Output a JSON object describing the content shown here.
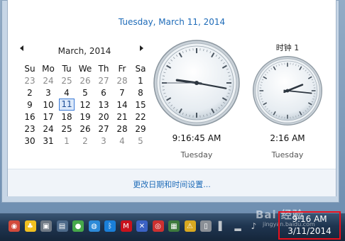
{
  "flyout": {
    "date_heading": "Tuesday, March 11, 2014",
    "settings_link": "更改日期和时间设置..."
  },
  "calendar": {
    "prev_icon": "triangle-left",
    "next_icon": "triangle-right",
    "month_title": "March, 2014",
    "weekdays": [
      "Su",
      "Mo",
      "Tu",
      "We",
      "Th",
      "Fr",
      "Sa"
    ],
    "weeks": [
      [
        {
          "d": "23",
          "o": true
        },
        {
          "d": "24",
          "o": true
        },
        {
          "d": "25",
          "o": true
        },
        {
          "d": "26",
          "o": true
        },
        {
          "d": "27",
          "o": true
        },
        {
          "d": "28",
          "o": true
        },
        {
          "d": "1",
          "o": false
        }
      ],
      [
        {
          "d": "2",
          "o": false
        },
        {
          "d": "3",
          "o": false
        },
        {
          "d": "4",
          "o": false
        },
        {
          "d": "5",
          "o": false
        },
        {
          "d": "6",
          "o": false
        },
        {
          "d": "7",
          "o": false
        },
        {
          "d": "8",
          "o": false
        }
      ],
      [
        {
          "d": "9",
          "o": false
        },
        {
          "d": "10",
          "o": false
        },
        {
          "d": "11",
          "o": false,
          "today": true
        },
        {
          "d": "12",
          "o": false
        },
        {
          "d": "13",
          "o": false
        },
        {
          "d": "14",
          "o": false
        },
        {
          "d": "15",
          "o": false
        }
      ],
      [
        {
          "d": "16",
          "o": false
        },
        {
          "d": "17",
          "o": false
        },
        {
          "d": "18",
          "o": false
        },
        {
          "d": "19",
          "o": false
        },
        {
          "d": "20",
          "o": false
        },
        {
          "d": "21",
          "o": false
        },
        {
          "d": "22",
          "o": false
        }
      ],
      [
        {
          "d": "23",
          "o": false
        },
        {
          "d": "24",
          "o": false
        },
        {
          "d": "25",
          "o": false
        },
        {
          "d": "26",
          "o": false
        },
        {
          "d": "27",
          "o": false
        },
        {
          "d": "28",
          "o": false
        },
        {
          "d": "29",
          "o": false
        }
      ],
      [
        {
          "d": "30",
          "o": false
        },
        {
          "d": "31",
          "o": false
        },
        {
          "d": "1",
          "o": true
        },
        {
          "d": "2",
          "o": true
        },
        {
          "d": "3",
          "o": true
        },
        {
          "d": "4",
          "o": true
        },
        {
          "d": "5",
          "o": true
        }
      ]
    ]
  },
  "clocks": [
    {
      "name": "",
      "time": "9:16:45 AM",
      "day": "Tuesday",
      "hour": 9,
      "minute": 16,
      "second": 45
    },
    {
      "name": "时钟 1",
      "time": "2:16 AM",
      "day": "Tuesday",
      "hour": 2,
      "minute": 16,
      "second": null
    }
  ],
  "taskbar": {
    "time": "9:16 AM",
    "date": "3/11/2014",
    "tray_icons": [
      "chrome-icon",
      "qq-icon",
      "app-icon",
      "network-share-icon",
      "wechat-icon",
      "browser-icon",
      "bluetooth-icon",
      "mcafee-icon",
      "security-icon",
      "power-icon",
      "flag-icon",
      "warning-icon",
      "usb-icon",
      "action-center-icon",
      "signal-icon",
      "volume-icon"
    ]
  },
  "watermark": {
    "text": "Bai 经验",
    "url": "jingyan.baidu.com"
  },
  "colors": {
    "link": "#1e6bb8",
    "today_border": "#3a7ad6",
    "highlight_box": "#e8101c"
  }
}
